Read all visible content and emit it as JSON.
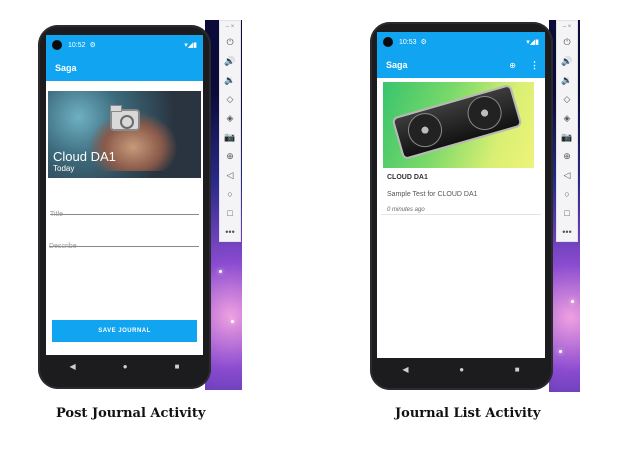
{
  "left_phone": {
    "status_time": "10:52",
    "app_title": "Saga",
    "hero_title": "Cloud DA1",
    "hero_subtitle": "Today",
    "title_placeholder": "Title",
    "describe_placeholder": "Describe",
    "save_label": "SAVE JOURNAL"
  },
  "right_phone": {
    "status_time": "10:53",
    "app_title": "Saga",
    "card_title": "CLOUD DA1",
    "card_body": "Sample Test for CLOUD DA1",
    "card_time": "0 minutes ago"
  },
  "captions": {
    "left": "Post Journal Activity",
    "right": "Journal List Activity"
  },
  "emulator_toolbar": {
    "top_controls": [
      "–",
      "×"
    ],
    "more": "•••"
  },
  "colors": {
    "app_bar": "#11a4f0",
    "button": "#11a4f0",
    "phone_body": "#1c1c1f"
  },
  "icons": [
    "camera-icon",
    "power-icon",
    "volume-up-icon",
    "volume-down-icon",
    "rotate-left-icon",
    "rotate-right-icon",
    "screenshot-icon",
    "zoom-icon",
    "back-icon",
    "home-icon",
    "overview-icon",
    "more-icon"
  ]
}
